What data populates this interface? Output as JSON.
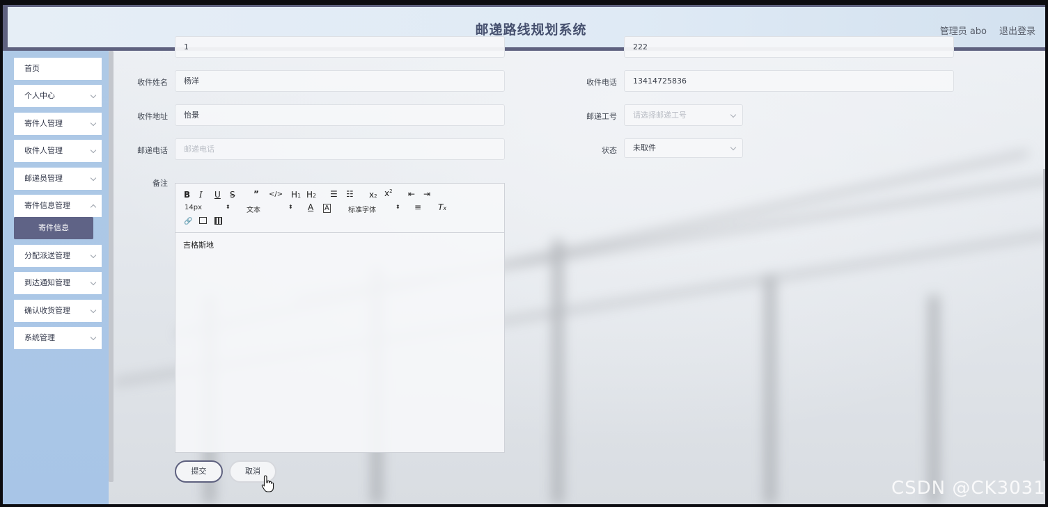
{
  "header": {
    "title": "邮递路线规划系统",
    "user_label": "管理员 abo",
    "logout_label": "退出登录"
  },
  "sidebar": {
    "items": [
      {
        "label": "首页",
        "has_children": false
      },
      {
        "label": "个人中心",
        "has_children": true
      },
      {
        "label": "寄件人管理",
        "has_children": true
      },
      {
        "label": "收件人管理",
        "has_children": true
      },
      {
        "label": "邮递员管理",
        "has_children": true
      },
      {
        "label": "寄件信息管理",
        "has_children": true
      },
      {
        "label": "分配派送管理",
        "has_children": true
      },
      {
        "label": "到达通知管理",
        "has_children": true
      },
      {
        "label": "确认收货管理",
        "has_children": true
      },
      {
        "label": "系统管理",
        "has_children": true
      }
    ],
    "active_submenu": "寄件信息"
  },
  "form": {
    "top_left_value": "1",
    "top_right_value": "222",
    "recipient_name_label": "收件姓名",
    "recipient_name_value": "杨洋",
    "recipient_phone_label": "收件电话",
    "recipient_phone_value": "13414725836",
    "recipient_address_label": "收件地址",
    "recipient_address_value": "怡景",
    "courier_id_label": "邮递工号",
    "courier_id_placeholder": "请选择邮递工号",
    "courier_phone_label": "邮递电话",
    "courier_phone_placeholder": "邮递电话",
    "status_label": "状态",
    "status_value": "未取件",
    "remark_label": "备注"
  },
  "editor": {
    "font_size": "14px",
    "block_format": "文本",
    "font_family": "标准字体",
    "content": "吉格斯地"
  },
  "buttons": {
    "submit": "提交",
    "cancel": "取消"
  },
  "watermark": "CSDN @CK3031"
}
